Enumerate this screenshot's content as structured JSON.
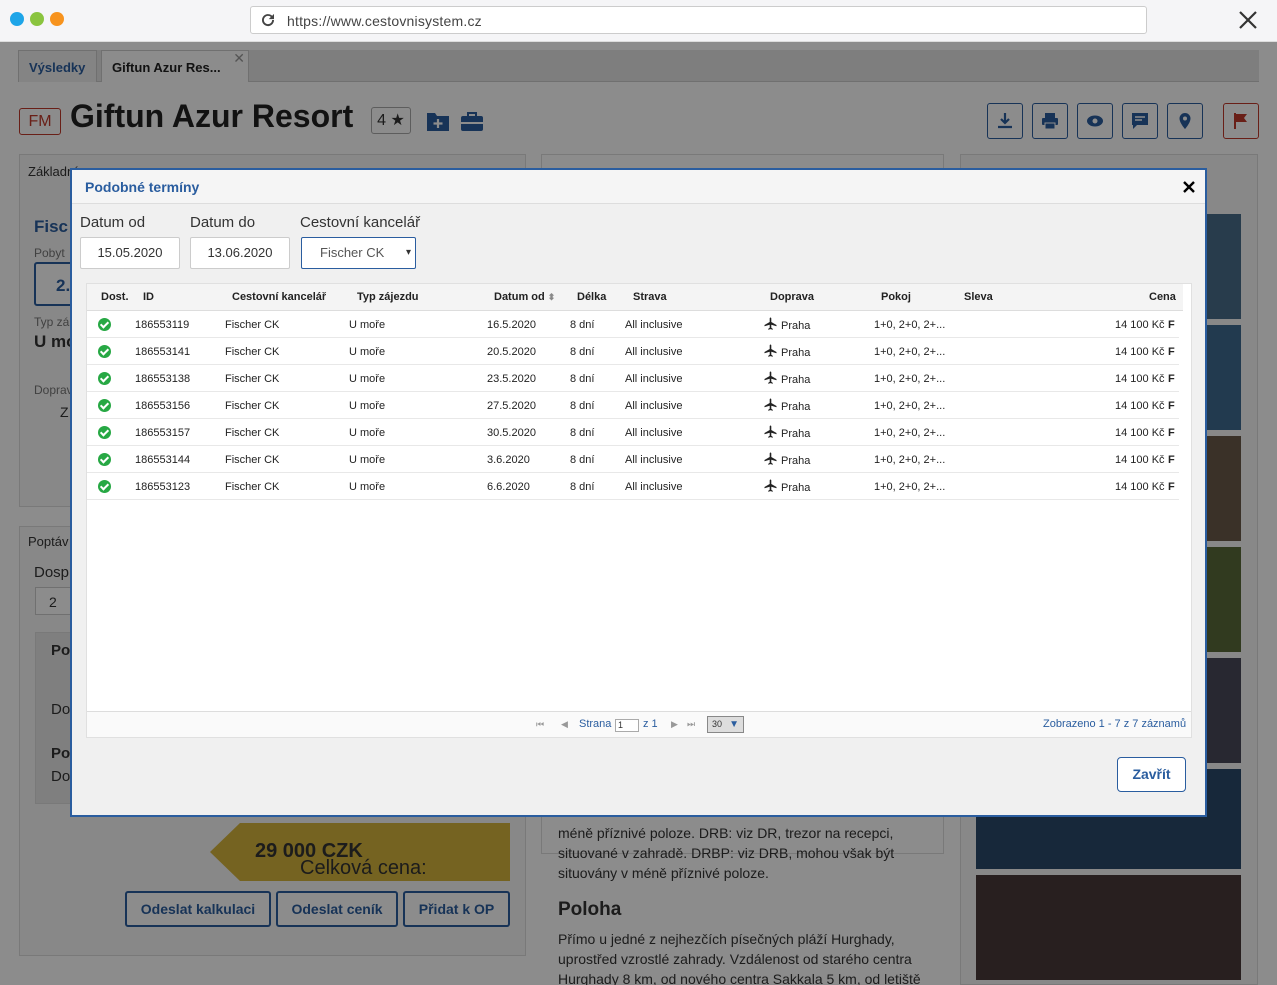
{
  "browser": {
    "url": "https://www.cestovnisystem.cz"
  },
  "tabs": [
    {
      "label": "Výsledky"
    },
    {
      "label": "Giftun Azur Res..."
    }
  ],
  "tab_close": "✕",
  "hotel": {
    "badge": "FM",
    "name": "Giftun Azur Resort",
    "stars": "4 ★"
  },
  "background": {
    "left_panel_label": "Základní",
    "agency_short": "Fisc",
    "pobyt": "Pobyt",
    "two": "2.",
    "typ": "Typ zá",
    "u_mo": "U mo",
    "doprava": "Doprav",
    "z": "Z",
    "poptav": "Poptáv",
    "dosp": "Dosp",
    "count": "2",
    "po1": "Po",
    "do1": "Do",
    "po2": "Po",
    "do2": "Do",
    "price_label": "Celková cena:",
    "price_value": "29 000 CZK",
    "btn_kalkulace": "Odeslat kalkulaci",
    "btn_cenik": "Odeslat ceník",
    "btn_op": "Přidat k OP",
    "desc1": "méně příznivé poloze. DRB: viz DR, trezor na recepci,",
    "desc2": "situované v zahradě. DRBP: viz DRB, mohou však být",
    "desc3": "situovány v méně příznivé poloze.",
    "poloha_title": "Poloha",
    "poloha1": "Přímo u jedné z nejhezčích písečných pláží Hurghady,",
    "poloha2": "uprostřed vzrostlé zahrady. Vzdálenost od starého centra",
    "poloha3": "Hurghady 8 km, od nového centra Sakkala 5 km, od letiště"
  },
  "modal": {
    "title": "Podobné termíny",
    "filters": {
      "date_from_label": "Datum od",
      "date_from": "15.05.2020",
      "date_to_label": "Datum do",
      "date_to": "13.06.2020",
      "agency_label": "Cestovní kancelář",
      "agency": "Fischer CK"
    },
    "columns": [
      "Dost.",
      "ID",
      "Cestovní kancelář",
      "Typ zájezdu",
      "Datum od",
      "Délka",
      "Strava",
      "Doprava",
      "Pokoj",
      "Sleva",
      "Cena"
    ],
    "sort_icon": "⬍",
    "rows": [
      {
        "id": "186553119",
        "ck": "Fischer CK",
        "typ": "U moře",
        "datum": "16.5.2020",
        "delka": "8 dní",
        "strava": "All inclusive",
        "doprava": "Praha",
        "pokoj": "1+0, 2+0, 2+...",
        "cena": "14 100 Kč",
        "flag": "F"
      },
      {
        "id": "186553141",
        "ck": "Fischer CK",
        "typ": "U moře",
        "datum": "20.5.2020",
        "delka": "8 dní",
        "strava": "All inclusive",
        "doprava": "Praha",
        "pokoj": "1+0, 2+0, 2+...",
        "cena": "14 100 Kč",
        "flag": "F"
      },
      {
        "id": "186553138",
        "ck": "Fischer CK",
        "typ": "U moře",
        "datum": "23.5.2020",
        "delka": "8 dní",
        "strava": "All inclusive",
        "doprava": "Praha",
        "pokoj": "1+0, 2+0, 2+...",
        "cena": "14 100 Kč",
        "flag": "F"
      },
      {
        "id": "186553156",
        "ck": "Fischer CK",
        "typ": "U moře",
        "datum": "27.5.2020",
        "delka": "8 dní",
        "strava": "All inclusive",
        "doprava": "Praha",
        "pokoj": "1+0, 2+0, 2+...",
        "cena": "14 100 Kč",
        "flag": "F"
      },
      {
        "id": "186553157",
        "ck": "Fischer CK",
        "typ": "U moře",
        "datum": "30.5.2020",
        "delka": "8 dní",
        "strava": "All inclusive",
        "doprava": "Praha",
        "pokoj": "1+0, 2+0, 2+...",
        "cena": "14 100 Kč",
        "flag": "F"
      },
      {
        "id": "186553144",
        "ck": "Fischer CK",
        "typ": "U moře",
        "datum": "3.6.2020",
        "delka": "8 dní",
        "strava": "All inclusive",
        "doprava": "Praha",
        "pokoj": "1+0, 2+0, 2+...",
        "cena": "14 100 Kč",
        "flag": "F"
      },
      {
        "id": "186553123",
        "ck": "Fischer CK",
        "typ": "U moře",
        "datum": "6.6.2020",
        "delka": "8 dní",
        "strava": "All inclusive",
        "doprava": "Praha",
        "pokoj": "1+0, 2+0, 2+...",
        "cena": "14 100 Kč",
        "flag": "F"
      }
    ],
    "pager": {
      "first": "⏮",
      "prev": "◀",
      "next": "▶",
      "last": "⏭",
      "page_label": "Strana",
      "page": "1",
      "of": "z 1",
      "page_size": "30",
      "dropdown": "▼",
      "summary": "Zobrazeno 1 - 7 z 7 záznamů"
    },
    "close_button": "Zavřít",
    "select_arrow": "▾"
  },
  "colors": {
    "accent": "#2a5d9f",
    "danger": "#c0392b",
    "ok": "#27a844",
    "price_bg": "#d5b43c"
  }
}
